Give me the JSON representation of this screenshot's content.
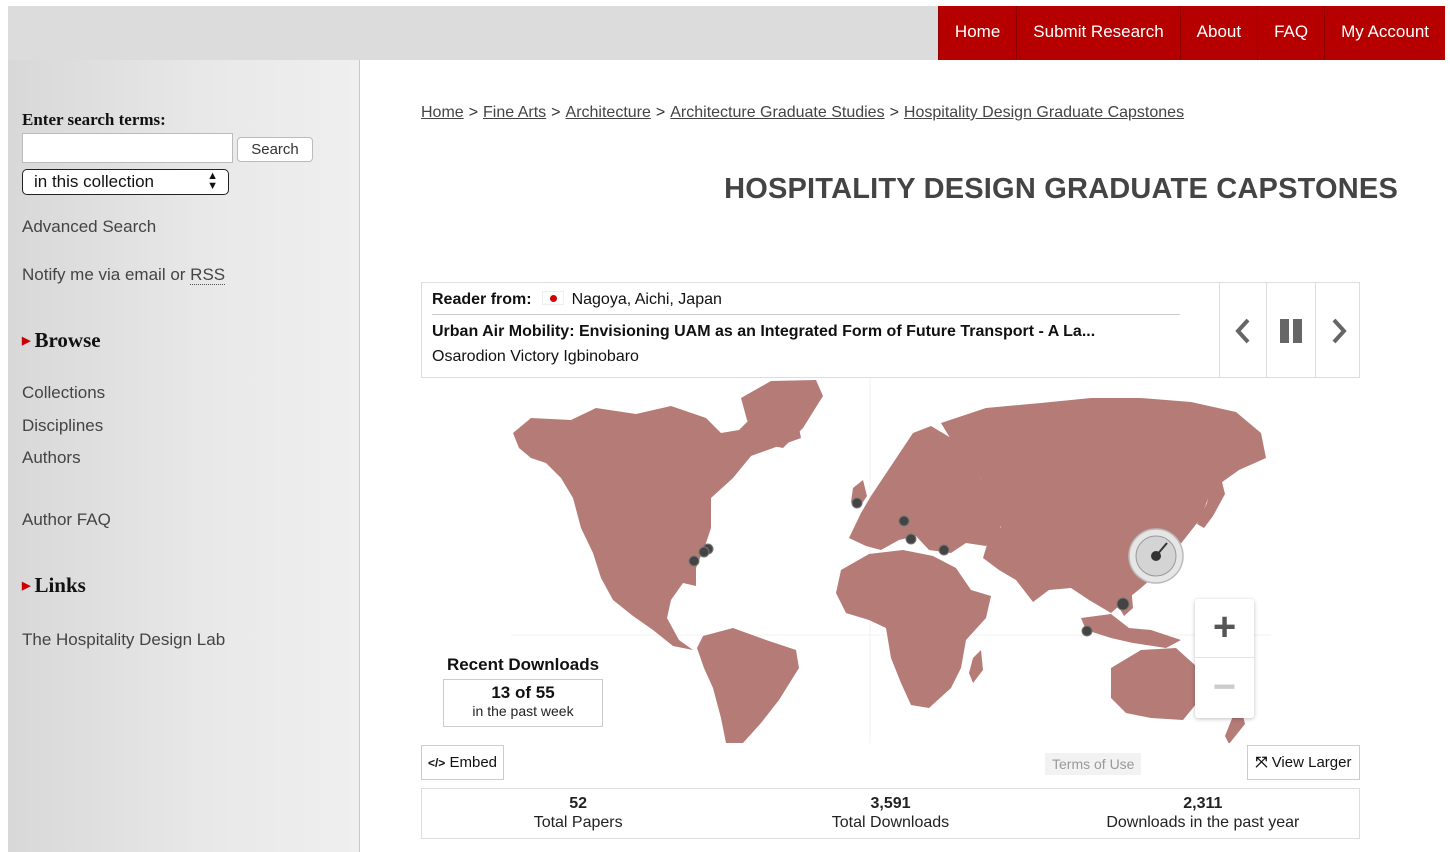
{
  "topnav": [
    "Home",
    "Submit Research",
    "About",
    "FAQ",
    "My Account"
  ],
  "sidebar": {
    "search_heading": "Enter search terms:",
    "search_value": "",
    "search_button": "Search",
    "scope_select": "in this collection",
    "advanced_search": "Advanced Search",
    "notify_prefix": "Notify me via email or ",
    "notify_rss": "RSS",
    "browse_heading": "Browse",
    "browse_items": [
      "Collections",
      "Disciplines",
      "Authors"
    ],
    "author_faq": "Author FAQ",
    "links_heading": "Links",
    "links_items": [
      "The Hospitality Design Lab"
    ]
  },
  "breadcrumb": [
    "Home",
    "Fine Arts",
    "Architecture",
    "Architecture Graduate Studies",
    "Hospitality Design Graduate Capstones"
  ],
  "breadcrumb_separator": ">",
  "page_title": "HOSPITALITY DESIGN GRADUATE CAPSTONES",
  "reader": {
    "label": "Reader from:",
    "flag_icon": "japan-flag-icon",
    "location": "Nagoya, Aichi, Japan",
    "paper_title": "Urban Air Mobility: Envisioning UAM as an Integrated Form of Future Transport - A La...",
    "author": "Osarodion Victory Igbinobaro"
  },
  "controls": {
    "prev_icon": "chevron-left-icon",
    "pause_icon": "pause-icon",
    "next_icon": "chevron-right-icon"
  },
  "map": {
    "land_color": "#b57b77",
    "marker_color": "#444444",
    "zoom_in": "+",
    "zoom_out": "−"
  },
  "recent_downloads": {
    "title": "Recent Downloads",
    "count": "13 of 55",
    "subtitle": "in the past week"
  },
  "embed_label": "Embed",
  "terms_label": "Terms of Use",
  "view_larger_label": "View Larger",
  "stats": [
    {
      "value": "52",
      "label": "Total Papers"
    },
    {
      "value": "3,591",
      "label": "Total Downloads"
    },
    {
      "value": "2,311",
      "label": "Downloads in the past year"
    }
  ],
  "accent_color": "#b60000"
}
